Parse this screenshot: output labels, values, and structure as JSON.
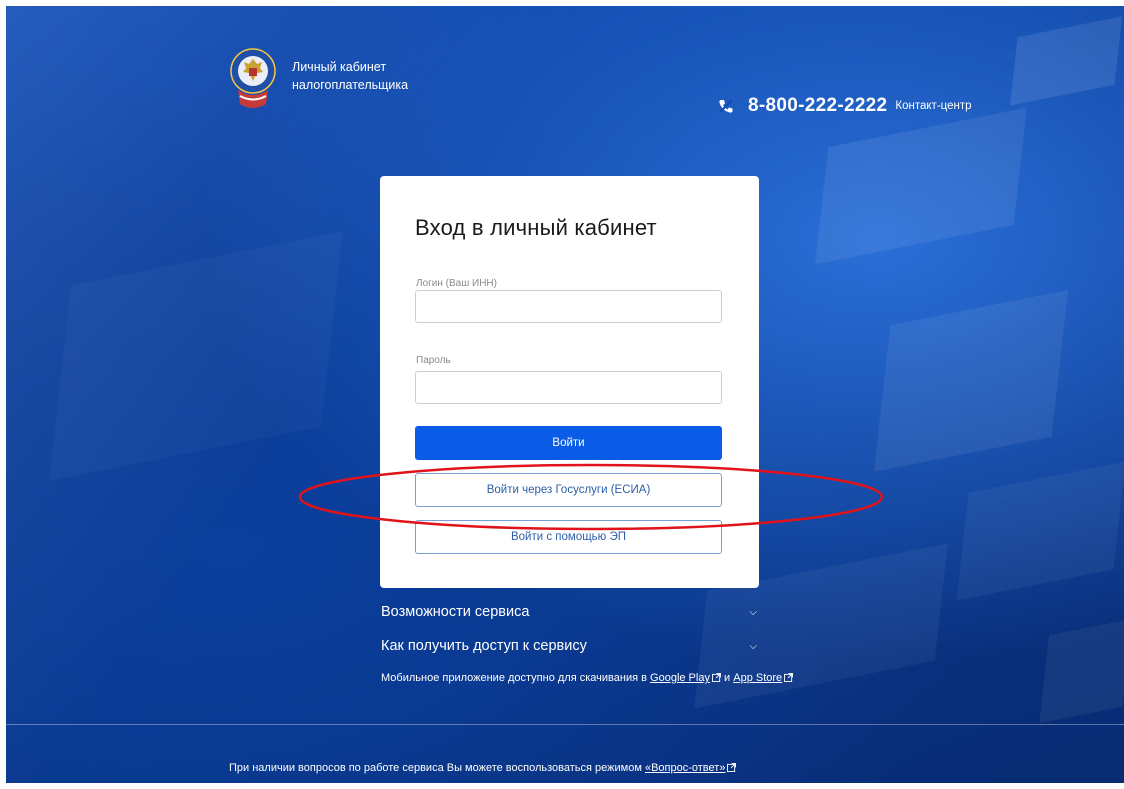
{
  "header": {
    "brand_line1": "Личный кабинет",
    "brand_line2": "налогоплательщика",
    "phone": "8-800-222-2222",
    "contact_label": "Контакт-центр",
    "phone_icon": "phone-icon"
  },
  "card": {
    "title": "Вход в личный кабинет",
    "login_label": "Логин (Ваш ИНН)",
    "login_value": "",
    "password_label": "Пароль",
    "password_value": "",
    "login_button": "Войти",
    "gosuslugi_button": "Войти через Госуслуги (ЕСИА)",
    "ep_button": "Войти с помощью ЭП"
  },
  "accordions": [
    {
      "label": "Возможности сервиса",
      "icon": "chevron-down-icon"
    },
    {
      "label": "Как получить доступ к сервису",
      "icon": "chevron-down-icon"
    }
  ],
  "mobile": {
    "text": "Мобильное приложение доступно для скачивания в",
    "google_play": "Google Play",
    "and": "и",
    "app_store": "App Store"
  },
  "footer": {
    "text": "При наличии вопросов по работе сервиса Вы можете воспользоваться режимом",
    "link": "«Вопрос-ответ»"
  },
  "colors": {
    "background": "#0a3a93",
    "primary_button": "#0a5ce6",
    "outline_button_border": "#7a9fd4",
    "annotation": "#e0131b"
  }
}
